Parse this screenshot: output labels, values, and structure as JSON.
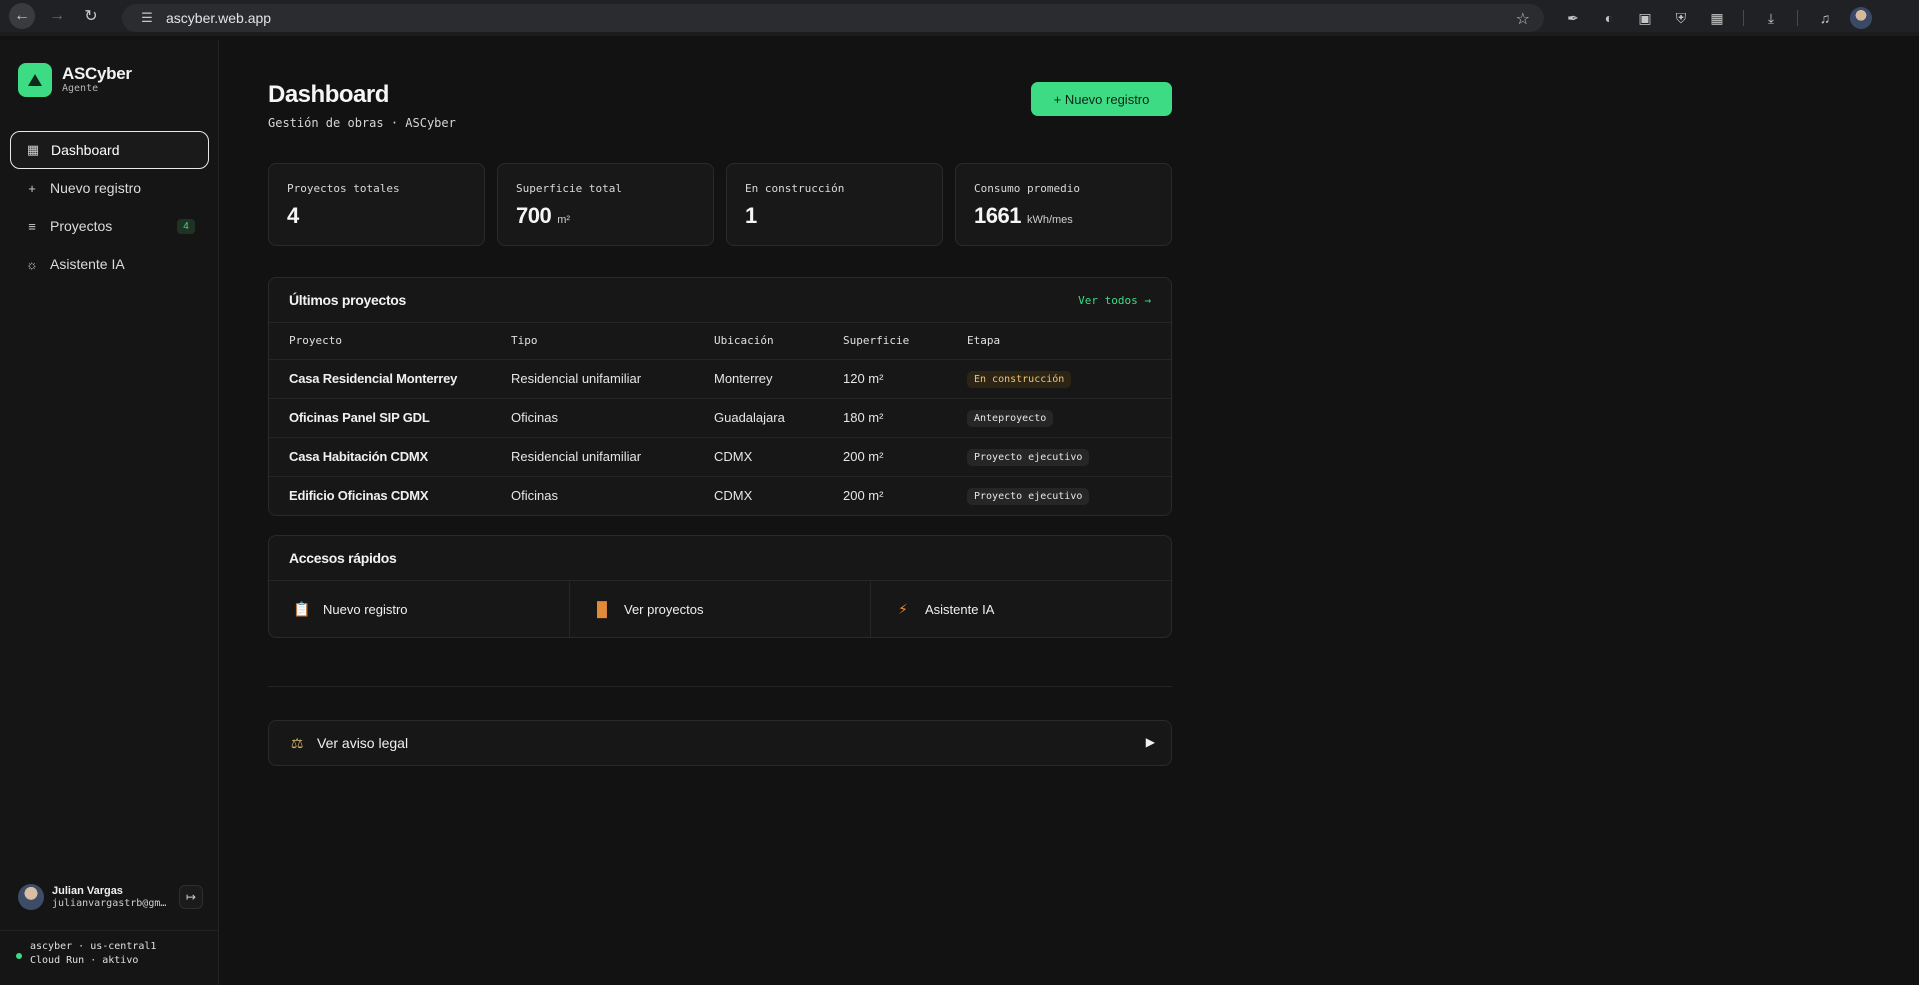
{
  "browser": {
    "url": "ascyber.web.app"
  },
  "brand": {
    "name": "ASCyber",
    "subtitle": "Agente"
  },
  "nav": {
    "items": [
      {
        "label": "Dashboard",
        "icon": "grid-icon",
        "active": true
      },
      {
        "label": "Nuevo registro",
        "icon": "plus-icon"
      },
      {
        "label": "Proyectos",
        "icon": "list-icon",
        "badge": "4"
      },
      {
        "label": "Asistente IA",
        "icon": "bulb-icon"
      }
    ]
  },
  "user": {
    "name": "Julian Vargas",
    "email": "julianvargastrb@gm…"
  },
  "server": {
    "line1": "ascyber · us-central1",
    "line2": "Cloud Run · aktivo"
  },
  "header": {
    "title": "Dashboard",
    "subtitle": "Gestión de obras · ASCyber",
    "new_button": "+ Nuevo registro"
  },
  "stats": [
    {
      "label": "Proyectos totales",
      "value": "4",
      "unit": ""
    },
    {
      "label": "Superficie total",
      "value": "700",
      "unit": "m²"
    },
    {
      "label": "En construcción",
      "value": "1",
      "unit": ""
    },
    {
      "label": "Consumo promedio",
      "value": "1661",
      "unit": "kWh/mes"
    }
  ],
  "projects": {
    "title": "Últimos proyectos",
    "link": "Ver todos →",
    "columns": [
      "Proyecto",
      "Tipo",
      "Ubicación",
      "Superficie",
      "Etapa"
    ],
    "rows": [
      {
        "name": "Casa Residencial Monterrey",
        "type": "Residencial unifamiliar",
        "location": "Monterrey",
        "area": "120 m²",
        "stage": "En construcción"
      },
      {
        "name": "Oficinas Panel SIP GDL",
        "type": "Oficinas",
        "location": "Guadalajara",
        "area": "180 m²",
        "stage": "Anteproyecto"
      },
      {
        "name": "Casa Habitación CDMX",
        "type": "Residencial unifamiliar",
        "location": "CDMX",
        "area": "200 m²",
        "stage": "Proyecto ejecutivo"
      },
      {
        "name": "Edificio Oficinas CDMX",
        "type": "Oficinas",
        "location": "CDMX",
        "area": "200 m²",
        "stage": "Proyecto ejecutivo"
      }
    ]
  },
  "quick": {
    "title": "Accesos rápidos",
    "items": [
      {
        "label": "Nuevo registro",
        "icon": "clipboard-icon"
      },
      {
        "label": "Ver proyectos",
        "icon": "crane-icon"
      },
      {
        "label": "Asistente IA",
        "icon": "lightning-icon"
      }
    ]
  },
  "legal": {
    "label": "Ver aviso legal",
    "icon": "scales-icon"
  }
}
